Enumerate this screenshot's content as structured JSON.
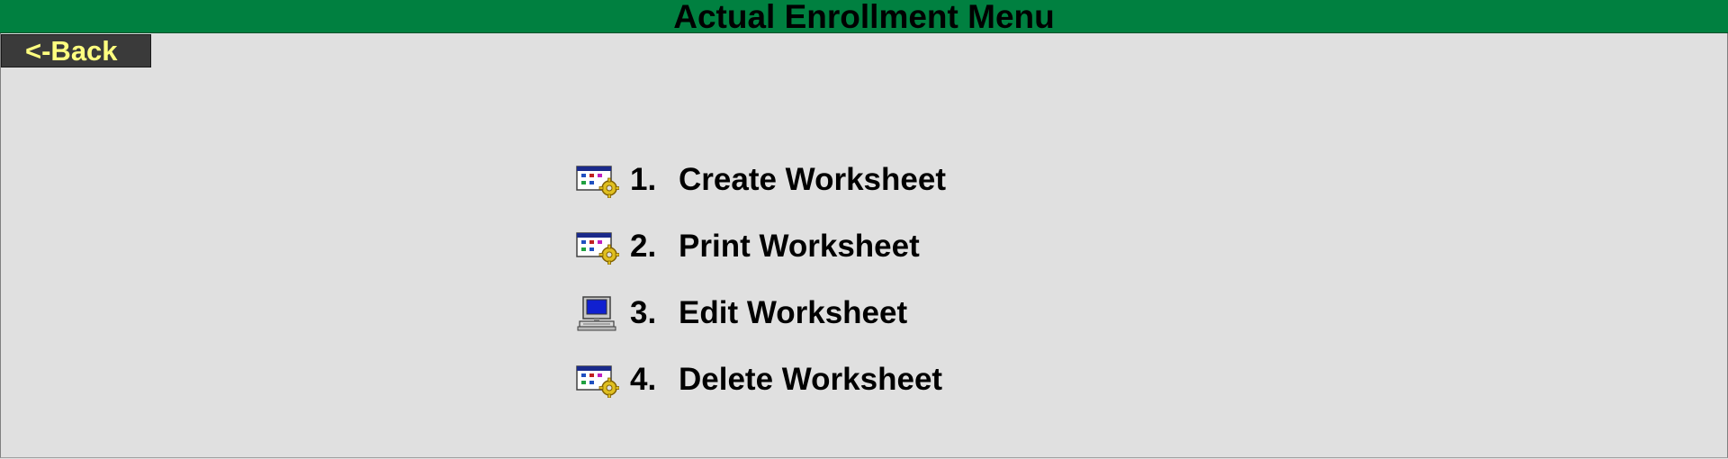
{
  "header": {
    "title": "Actual Enrollment Menu",
    "back_label": "<-Back"
  },
  "menu": {
    "items": [
      {
        "number": "1.",
        "label": "Create Worksheet",
        "icon": "window-gear-icon"
      },
      {
        "number": "2.",
        "label": "Print Worksheet",
        "icon": "window-gear-icon"
      },
      {
        "number": "3.",
        "label": "Edit Worksheet",
        "icon": "computer-icon"
      },
      {
        "number": "4.",
        "label": "Delete Worksheet",
        "icon": "window-gear-icon"
      }
    ]
  },
  "colors": {
    "title_bar": "#008040",
    "background": "#e0e0e0",
    "back_button_bg": "#3a3a3a",
    "back_button_text": "#ffff80"
  }
}
